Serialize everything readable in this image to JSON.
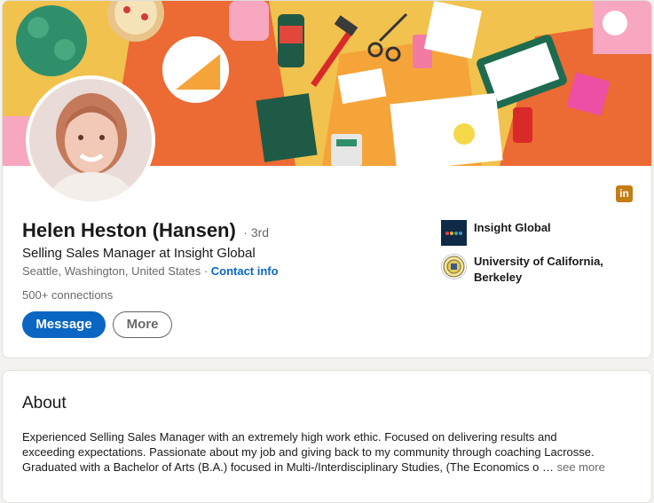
{
  "profile": {
    "name": "Helen Heston (Hansen)",
    "degree": "· 3rd",
    "headline": "Selling Sales Manager at Insight Global",
    "location": "Seattle, Washington, United States",
    "separator": "·",
    "contact_info": "Contact info",
    "connections": "500+ connections",
    "message_button": "Message",
    "more_button": "More",
    "network_badge": "in"
  },
  "organizations": {
    "company": "Insight Global",
    "school": "University of California, Berkeley"
  },
  "about": {
    "title": "About",
    "line1": "Experienced Selling Sales Manager with an extremely high work ethic. Focused on delivering results and",
    "line2": "exceeding expectations. Passionate about my job and giving back to my community through coaching Lacrosse.",
    "line3": "Graduated with a Bachelor of Arts (B.A.) focused in Multi-/Interdisciplinary Studies, (The Economics o …",
    "see_more": "see more"
  },
  "colors": {
    "accent": "#0a66c2",
    "banner_bg": "#f1c24d",
    "badge": "#c37d16"
  }
}
